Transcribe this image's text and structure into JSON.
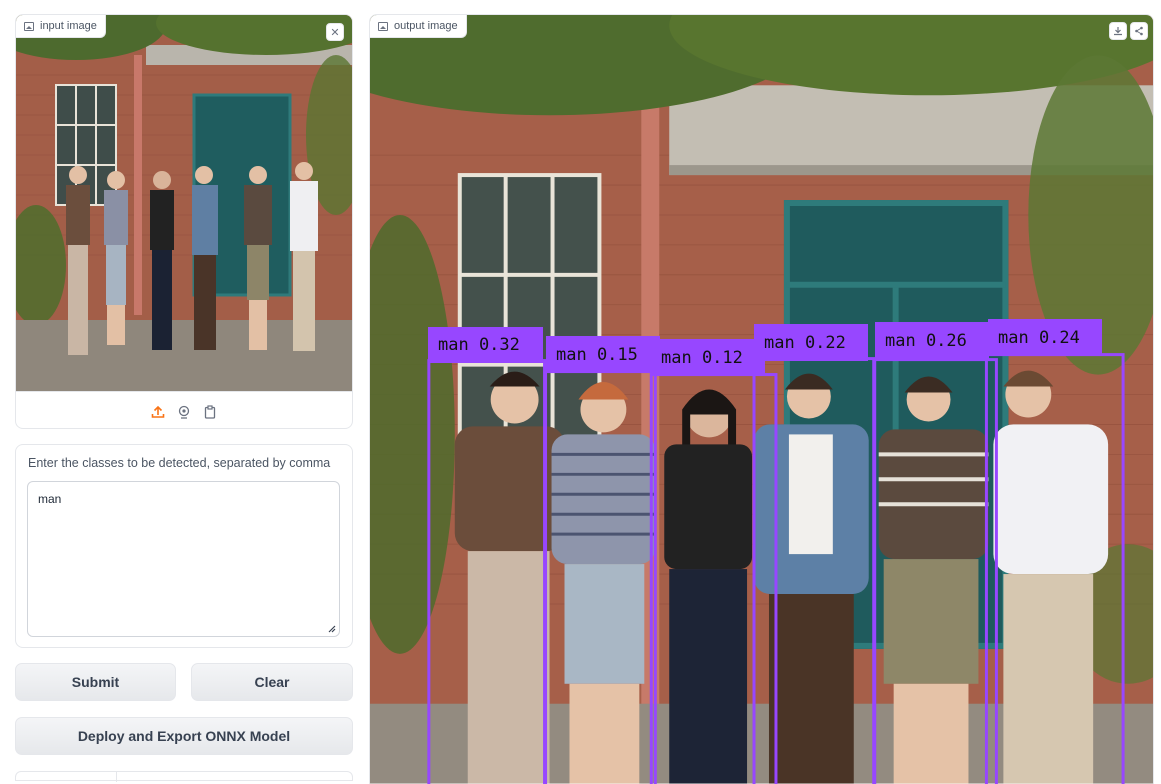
{
  "input_panel": {
    "label": "input image",
    "close_symbol": "✕",
    "image_description": "photo of six men standing in front of a brick building",
    "source_icons": [
      "upload-icon",
      "webcam-icon",
      "clipboard-icon"
    ]
  },
  "prompt": {
    "label": "Enter the classes to be detected, separated by comma",
    "value": "man"
  },
  "buttons": {
    "submit": "Submit",
    "clear": "Clear",
    "deploy": "Deploy and Export ONNX Model"
  },
  "output_panel": {
    "label": "output image",
    "actions": [
      "download-icon",
      "share-icon"
    ],
    "detections": [
      {
        "label": "man 0.32"
      },
      {
        "label": "man 0.15"
      },
      {
        "label": "man 0.12"
      },
      {
        "label": "man 0.22"
      },
      {
        "label": "man 0.26"
      },
      {
        "label": "man 0.24"
      }
    ]
  },
  "colors": {
    "accent": "#f97316",
    "bbox": "#9747ff"
  }
}
